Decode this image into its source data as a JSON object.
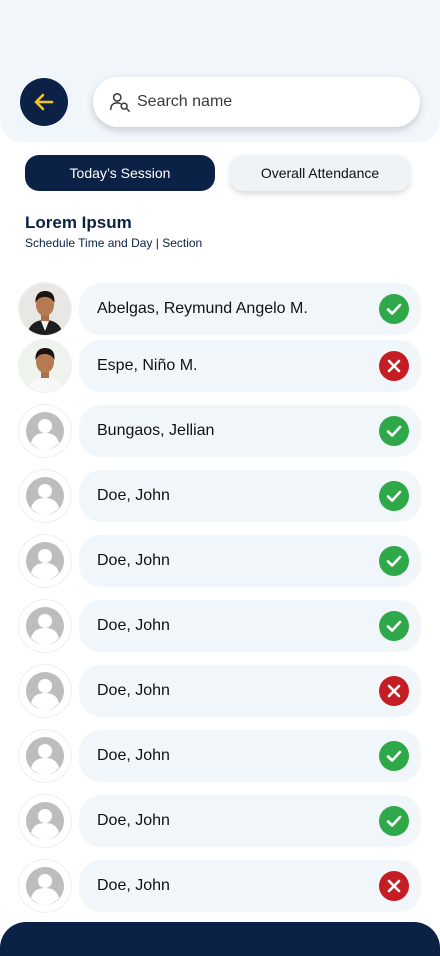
{
  "header": {
    "back_icon": "arrow-left-icon",
    "search": {
      "placeholder": "Search name",
      "value": "",
      "icon": "user-search-icon"
    }
  },
  "tabs": [
    {
      "label": "Today’s Session",
      "active": true
    },
    {
      "label": "Overall Attendance",
      "active": false
    }
  ],
  "class_info": {
    "title": "Lorem Ipsum",
    "subtitle": "Schedule Time and Day | Section"
  },
  "students": [
    {
      "name": "Abelgas, Reymund Angelo M.",
      "status": "present",
      "avatar": "photo-1"
    },
    {
      "name": "Espe, Niño M.",
      "status": "absent",
      "avatar": "photo-2"
    },
    {
      "name": "Bungaos, Jellian",
      "status": "present",
      "avatar": "placeholder"
    },
    {
      "name": "Doe, John",
      "status": "present",
      "avatar": "placeholder"
    },
    {
      "name": "Doe, John",
      "status": "present",
      "avatar": "placeholder"
    },
    {
      "name": "Doe, John",
      "status": "present",
      "avatar": "placeholder"
    },
    {
      "name": "Doe, John",
      "status": "absent",
      "avatar": "placeholder"
    },
    {
      "name": "Doe, John",
      "status": "present",
      "avatar": "placeholder"
    },
    {
      "name": "Doe, John",
      "status": "present",
      "avatar": "placeholder"
    },
    {
      "name": "Doe, John",
      "status": "absent",
      "avatar": "placeholder"
    }
  ],
  "colors": {
    "primary": "#0b2146",
    "accent": "#f5c518",
    "present": "#2fa84a",
    "absent": "#c41e24",
    "pill_bg": "#f1f6fb"
  }
}
